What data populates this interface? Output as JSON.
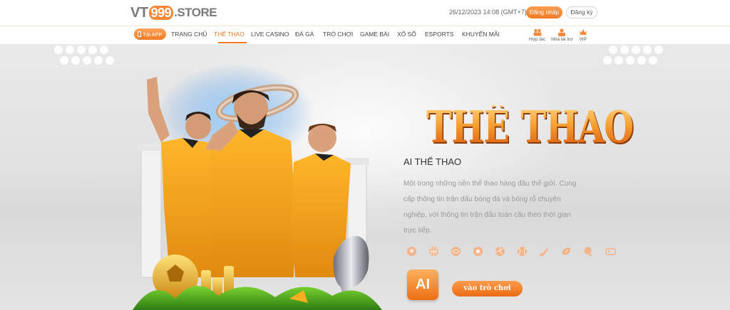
{
  "header": {
    "logo": {
      "prefix": "VT",
      "number": "999",
      "suffix": ".STORE"
    },
    "datetime": "26/12/2023 14:08  (GMT+7)",
    "login_label": "Đăng nhập",
    "register_label": "Đăng ký"
  },
  "nav": {
    "app_button": "Tải APP",
    "items": [
      {
        "label": "TRANG CHỦ",
        "active": false
      },
      {
        "label": "THỂ THAO",
        "active": true
      },
      {
        "label": "LIVE CASINO",
        "active": false
      },
      {
        "label": "ĐÁ GÀ",
        "active": false
      },
      {
        "label": "TRÒ CHƠI",
        "active": false
      },
      {
        "label": "GAME BÀI",
        "active": false
      },
      {
        "label": "XỔ SỐ",
        "active": false
      },
      {
        "label": "ESPORTS",
        "active": false
      },
      {
        "label": "KHUYẾN MÃI",
        "active": false
      }
    ],
    "right_icons": [
      {
        "label": "Hợp tác",
        "icon": "partnership-icon"
      },
      {
        "label": "Nhà tài trợ",
        "icon": "sponsor-icon"
      },
      {
        "label": "VIP",
        "icon": "crown-icon"
      }
    ]
  },
  "banner": {
    "title": "THỂ THAO",
    "subtitle": "AI THỂ THAO",
    "description": "Một trong những nền thể thao hàng đầu thế giới. Cung cấp thông tin trận đấu bóng đá và bóng rổ chuyên nghiệp, với thông tin trận đấu toàn cầu theo thời gian trực tiếp.",
    "sport_icons": [
      "soccer-icon",
      "basketball-icon",
      "rugby-icon",
      "billiards-icon",
      "volleyball-icon",
      "tennis-icon",
      "badminton-icon",
      "american-football-icon",
      "table-tennis-icon",
      "esports-icon"
    ],
    "ai_label": "AI",
    "play_button": "vào trò chơi"
  },
  "colors": {
    "accent": "#f07a22",
    "accent_dark": "#d85a10",
    "text_muted": "#9a9a9a"
  }
}
